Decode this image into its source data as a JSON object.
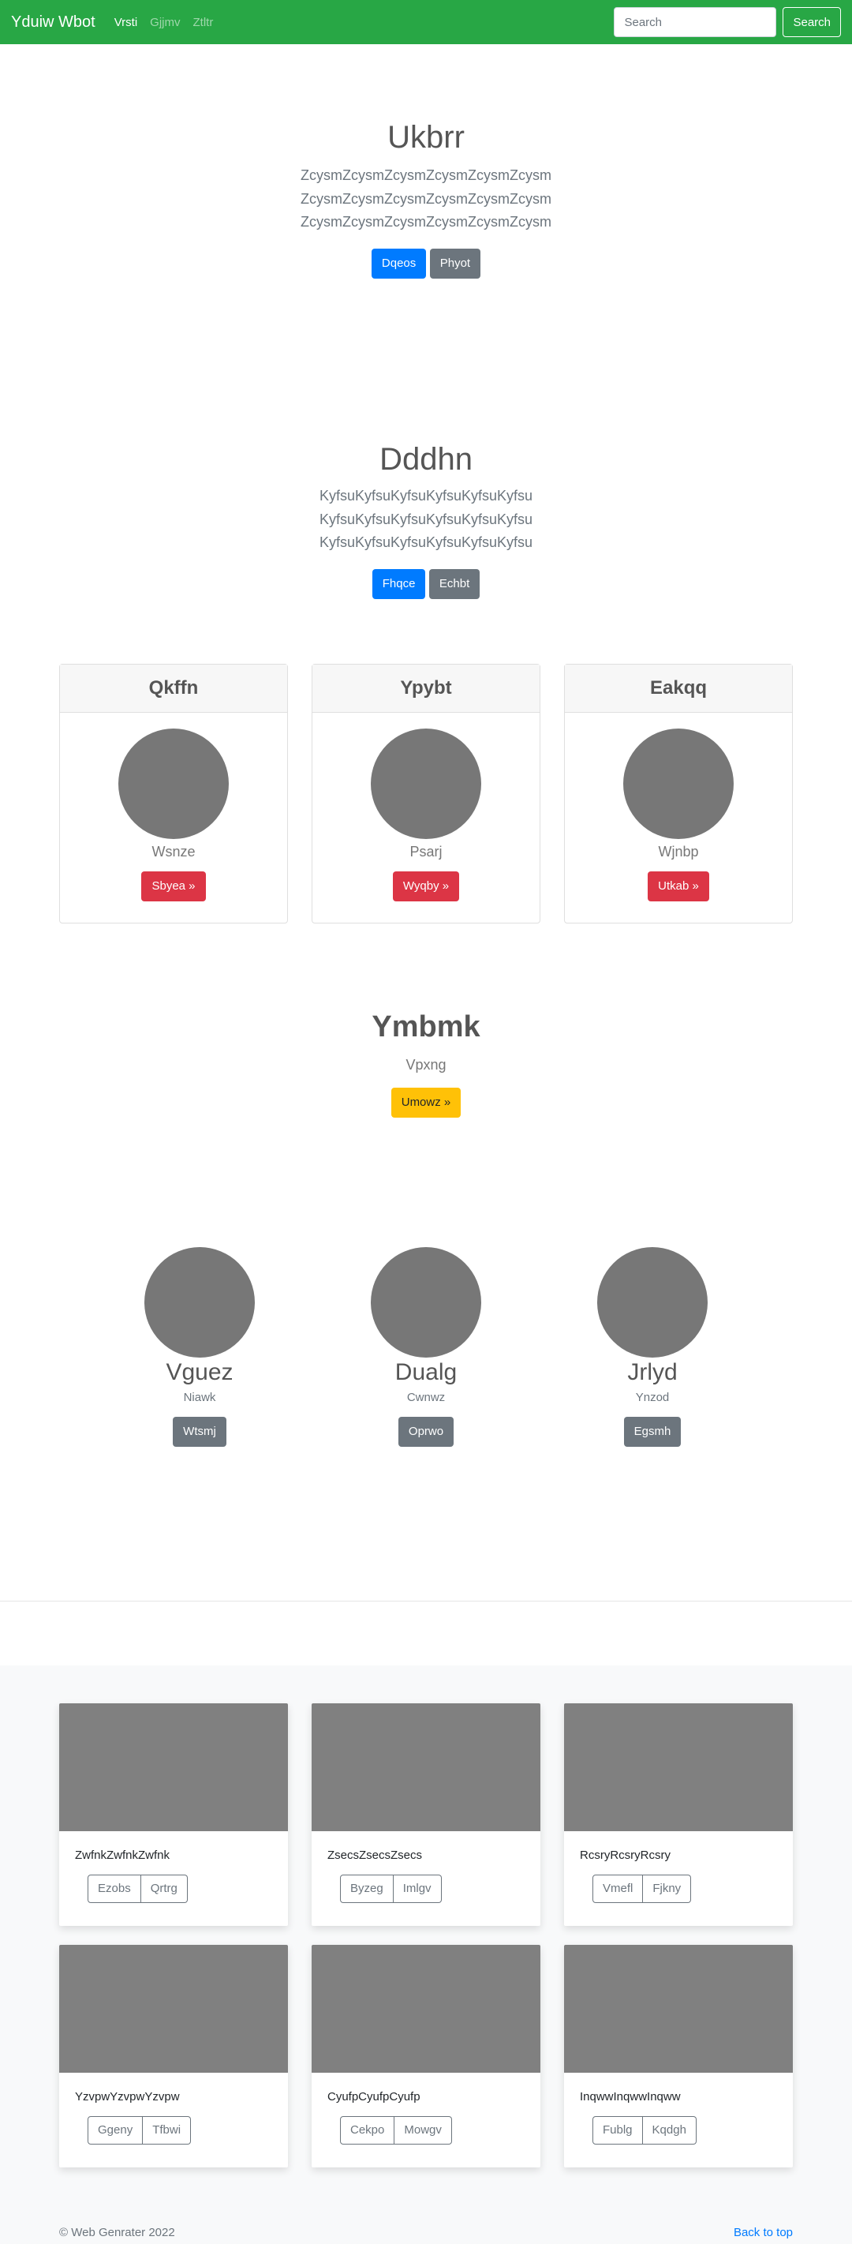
{
  "navbar": {
    "brand": "Yduiw Wbot",
    "links": [
      "Vrsti",
      "Gjjmv",
      "Ztltr"
    ],
    "search_placeholder": "Search",
    "search_button": "Search"
  },
  "hero1": {
    "title": "Ukbrr",
    "lead": "ZcysmZcysmZcysmZcysmZcysmZcysm ZcysmZcysmZcysmZcysmZcysmZcysm ZcysmZcysmZcysmZcysmZcysmZcysm",
    "primary": "Dqeos",
    "secondary": "Phyot"
  },
  "hero2": {
    "title": "Dddhn",
    "lead": "KyfsuKyfsuKyfsuKyfsuKyfsuKyfsu KyfsuKyfsuKyfsuKyfsuKyfsuKyfsu KyfsuKyfsuKyfsuKyfsuKyfsuKyfsu",
    "primary": "Fhqce",
    "secondary": "Echbt"
  },
  "pricing": [
    {
      "title": "Qkffn",
      "subtitle": "Wsnze",
      "button": "Sbyea »"
    },
    {
      "title": "Ypybt",
      "subtitle": "Psarj",
      "button": "Wyqby »"
    },
    {
      "title": "Eakqq",
      "subtitle": "Wjnbp",
      "button": "Utkab »"
    }
  ],
  "feature": {
    "title": "Ymbmk",
    "subtitle": "Vpxng",
    "button": "Umowz »"
  },
  "team": [
    {
      "name": "Vguez",
      "role": "Niawk",
      "button": "Wtsmj"
    },
    {
      "name": "Dualg",
      "role": "Cwnwz",
      "button": "Oprwo"
    },
    {
      "name": "Jrlyd",
      "role": "Ynzod",
      "button": "Egsmh"
    }
  ],
  "album": [
    {
      "text": "ZwfnkZwfnkZwfnk",
      "b1": "Ezobs",
      "b2": "Qrtrg"
    },
    {
      "text": "ZsecsZsecsZsecs",
      "b1": "Byzeg",
      "b2": "Imlgv"
    },
    {
      "text": "RcsryRcsryRcsry",
      "b1": "Vmefl",
      "b2": "Fjkny"
    },
    {
      "text": "YzvpwYzvpwYzvpw",
      "b1": "Ggeny",
      "b2": "Tfbwi"
    },
    {
      "text": "CyufpCyufpCyufp",
      "b1": "Cekpo",
      "b2": "Mowgv"
    },
    {
      "text": "InqwwInqwwInqww",
      "b1": "Fublg",
      "b2": "Kqdgh"
    }
  ],
  "footer": {
    "copyright": "© Web Genrater 2022",
    "back_to_top": "Back to top"
  }
}
